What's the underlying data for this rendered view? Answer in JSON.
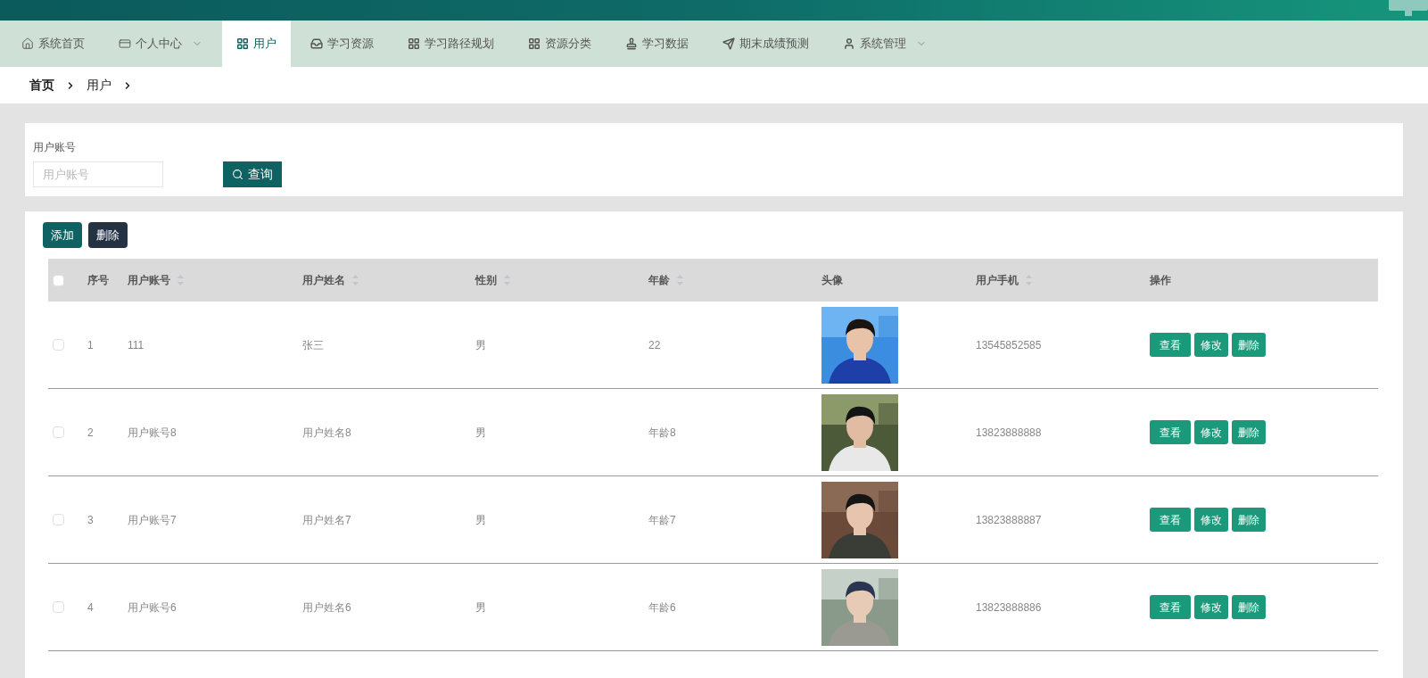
{
  "nav": {
    "items": [
      {
        "label": "系统首页",
        "dropdown": false,
        "selected": false
      },
      {
        "label": "个人中心",
        "dropdown": true,
        "selected": false
      },
      {
        "label": "用户",
        "dropdown": false,
        "selected": true
      },
      {
        "label": "学习资源",
        "dropdown": false,
        "selected": false
      },
      {
        "label": "学习路径规划",
        "dropdown": false,
        "selected": false
      },
      {
        "label": "资源分类",
        "dropdown": false,
        "selected": false
      },
      {
        "label": "学习数据",
        "dropdown": false,
        "selected": false
      },
      {
        "label": "期末成绩预测",
        "dropdown": false,
        "selected": false
      },
      {
        "label": "系统管理",
        "dropdown": true,
        "selected": false
      }
    ]
  },
  "breadcrumb": [
    "首页",
    "用户"
  ],
  "search": {
    "label": "用户账号",
    "placeholder": "用户账号",
    "button": "查询"
  },
  "toolbar": {
    "add": "添加",
    "delete": "删除"
  },
  "table": {
    "header_checked": false,
    "columns": [
      {
        "label": "序号",
        "sortable": false
      },
      {
        "label": "用户账号",
        "sortable": true
      },
      {
        "label": "用户姓名",
        "sortable": true
      },
      {
        "label": "性别",
        "sortable": true
      },
      {
        "label": "年龄",
        "sortable": true
      },
      {
        "label": "头像",
        "sortable": false
      },
      {
        "label": "用户手机",
        "sortable": true
      },
      {
        "label": "操作",
        "sortable": false
      }
    ],
    "rows": [
      {
        "checked": false,
        "index": "1",
        "account": "111",
        "name": "张三",
        "gender": "男",
        "age": "22",
        "phone": "13545852585",
        "avatar": {
          "kind": "picture"
        },
        "actions": [
          "查看",
          "修改",
          "删除"
        ]
      },
      {
        "checked": false,
        "index": "2",
        "account": "用户账号8",
        "name": "用户姓名8",
        "gender": "男",
        "age": "年龄8",
        "phone": "13823888888",
        "avatar": {
          "kind": "picture"
        },
        "actions": [
          "查看",
          "修改",
          "删除"
        ]
      },
      {
        "checked": false,
        "index": "3",
        "account": "用户账号7",
        "name": "用户姓名7",
        "gender": "男",
        "age": "年龄7",
        "phone": "13823888887",
        "avatar": {
          "kind": "picture"
        },
        "actions": [
          "查看",
          "修改",
          "删除"
        ]
      },
      {
        "checked": false,
        "index": "4",
        "account": "用户账号6",
        "name": "用户姓名6",
        "gender": "男",
        "age": "年龄6",
        "phone": "13823888886",
        "avatar": {
          "kind": "picture"
        },
        "actions": [
          "查看",
          "修改",
          "删除"
        ]
      }
    ]
  }
}
